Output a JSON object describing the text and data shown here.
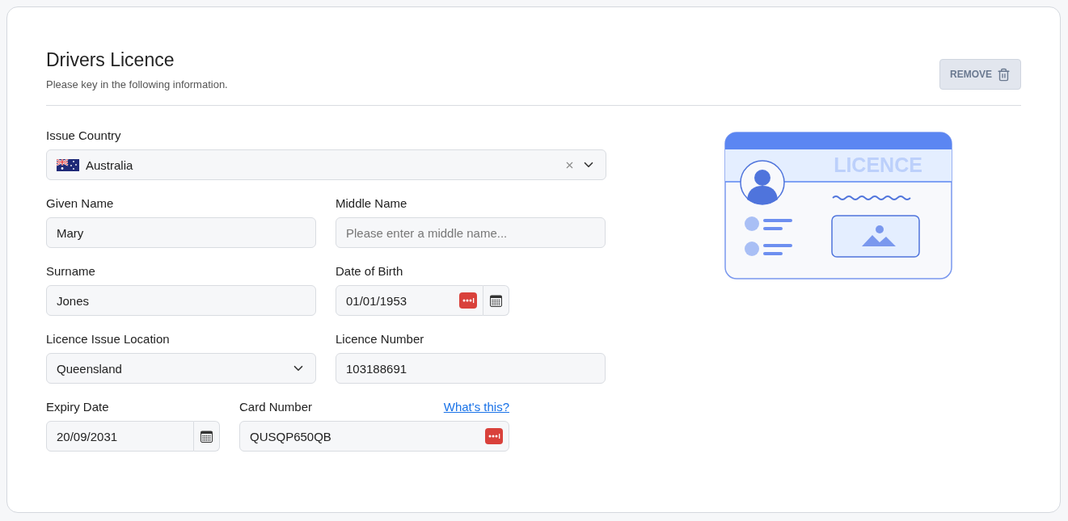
{
  "title": "Drivers Licence",
  "subtitle": "Please key in the following information.",
  "remove_button": "REMOVE",
  "rows": [
    [
      {
        "kind": "country",
        "label": "Issue Country",
        "value": "Australia"
      }
    ],
    [
      {
        "kind": "text",
        "label": "Given Name",
        "value": "Mary",
        "autofill": false
      },
      {
        "kind": "text",
        "label": "Middle Name",
        "placeholder": "Please enter a middle name...",
        "autofill": false
      }
    ],
    [
      {
        "kind": "text",
        "label": "Surname",
        "value": "Jones",
        "autofill": false
      },
      {
        "kind": "date",
        "label": "Date of Birth",
        "value": "01/01/1953",
        "autofill": true
      }
    ],
    [
      {
        "kind": "select",
        "label": "Licence Issue Location",
        "value": "Queensland"
      },
      {
        "kind": "text",
        "label": "Licence Number",
        "value": "103188691",
        "autofill": false
      }
    ],
    [
      {
        "kind": "date",
        "label": "Expiry Date",
        "value": "20/09/2031",
        "autofill": false
      },
      {
        "kind": "text",
        "label": "Card Number",
        "value": "QUSQP650QB",
        "link": "What's this?",
        "autofill": true
      }
    ]
  ],
  "illustration_label": "LICENCE"
}
